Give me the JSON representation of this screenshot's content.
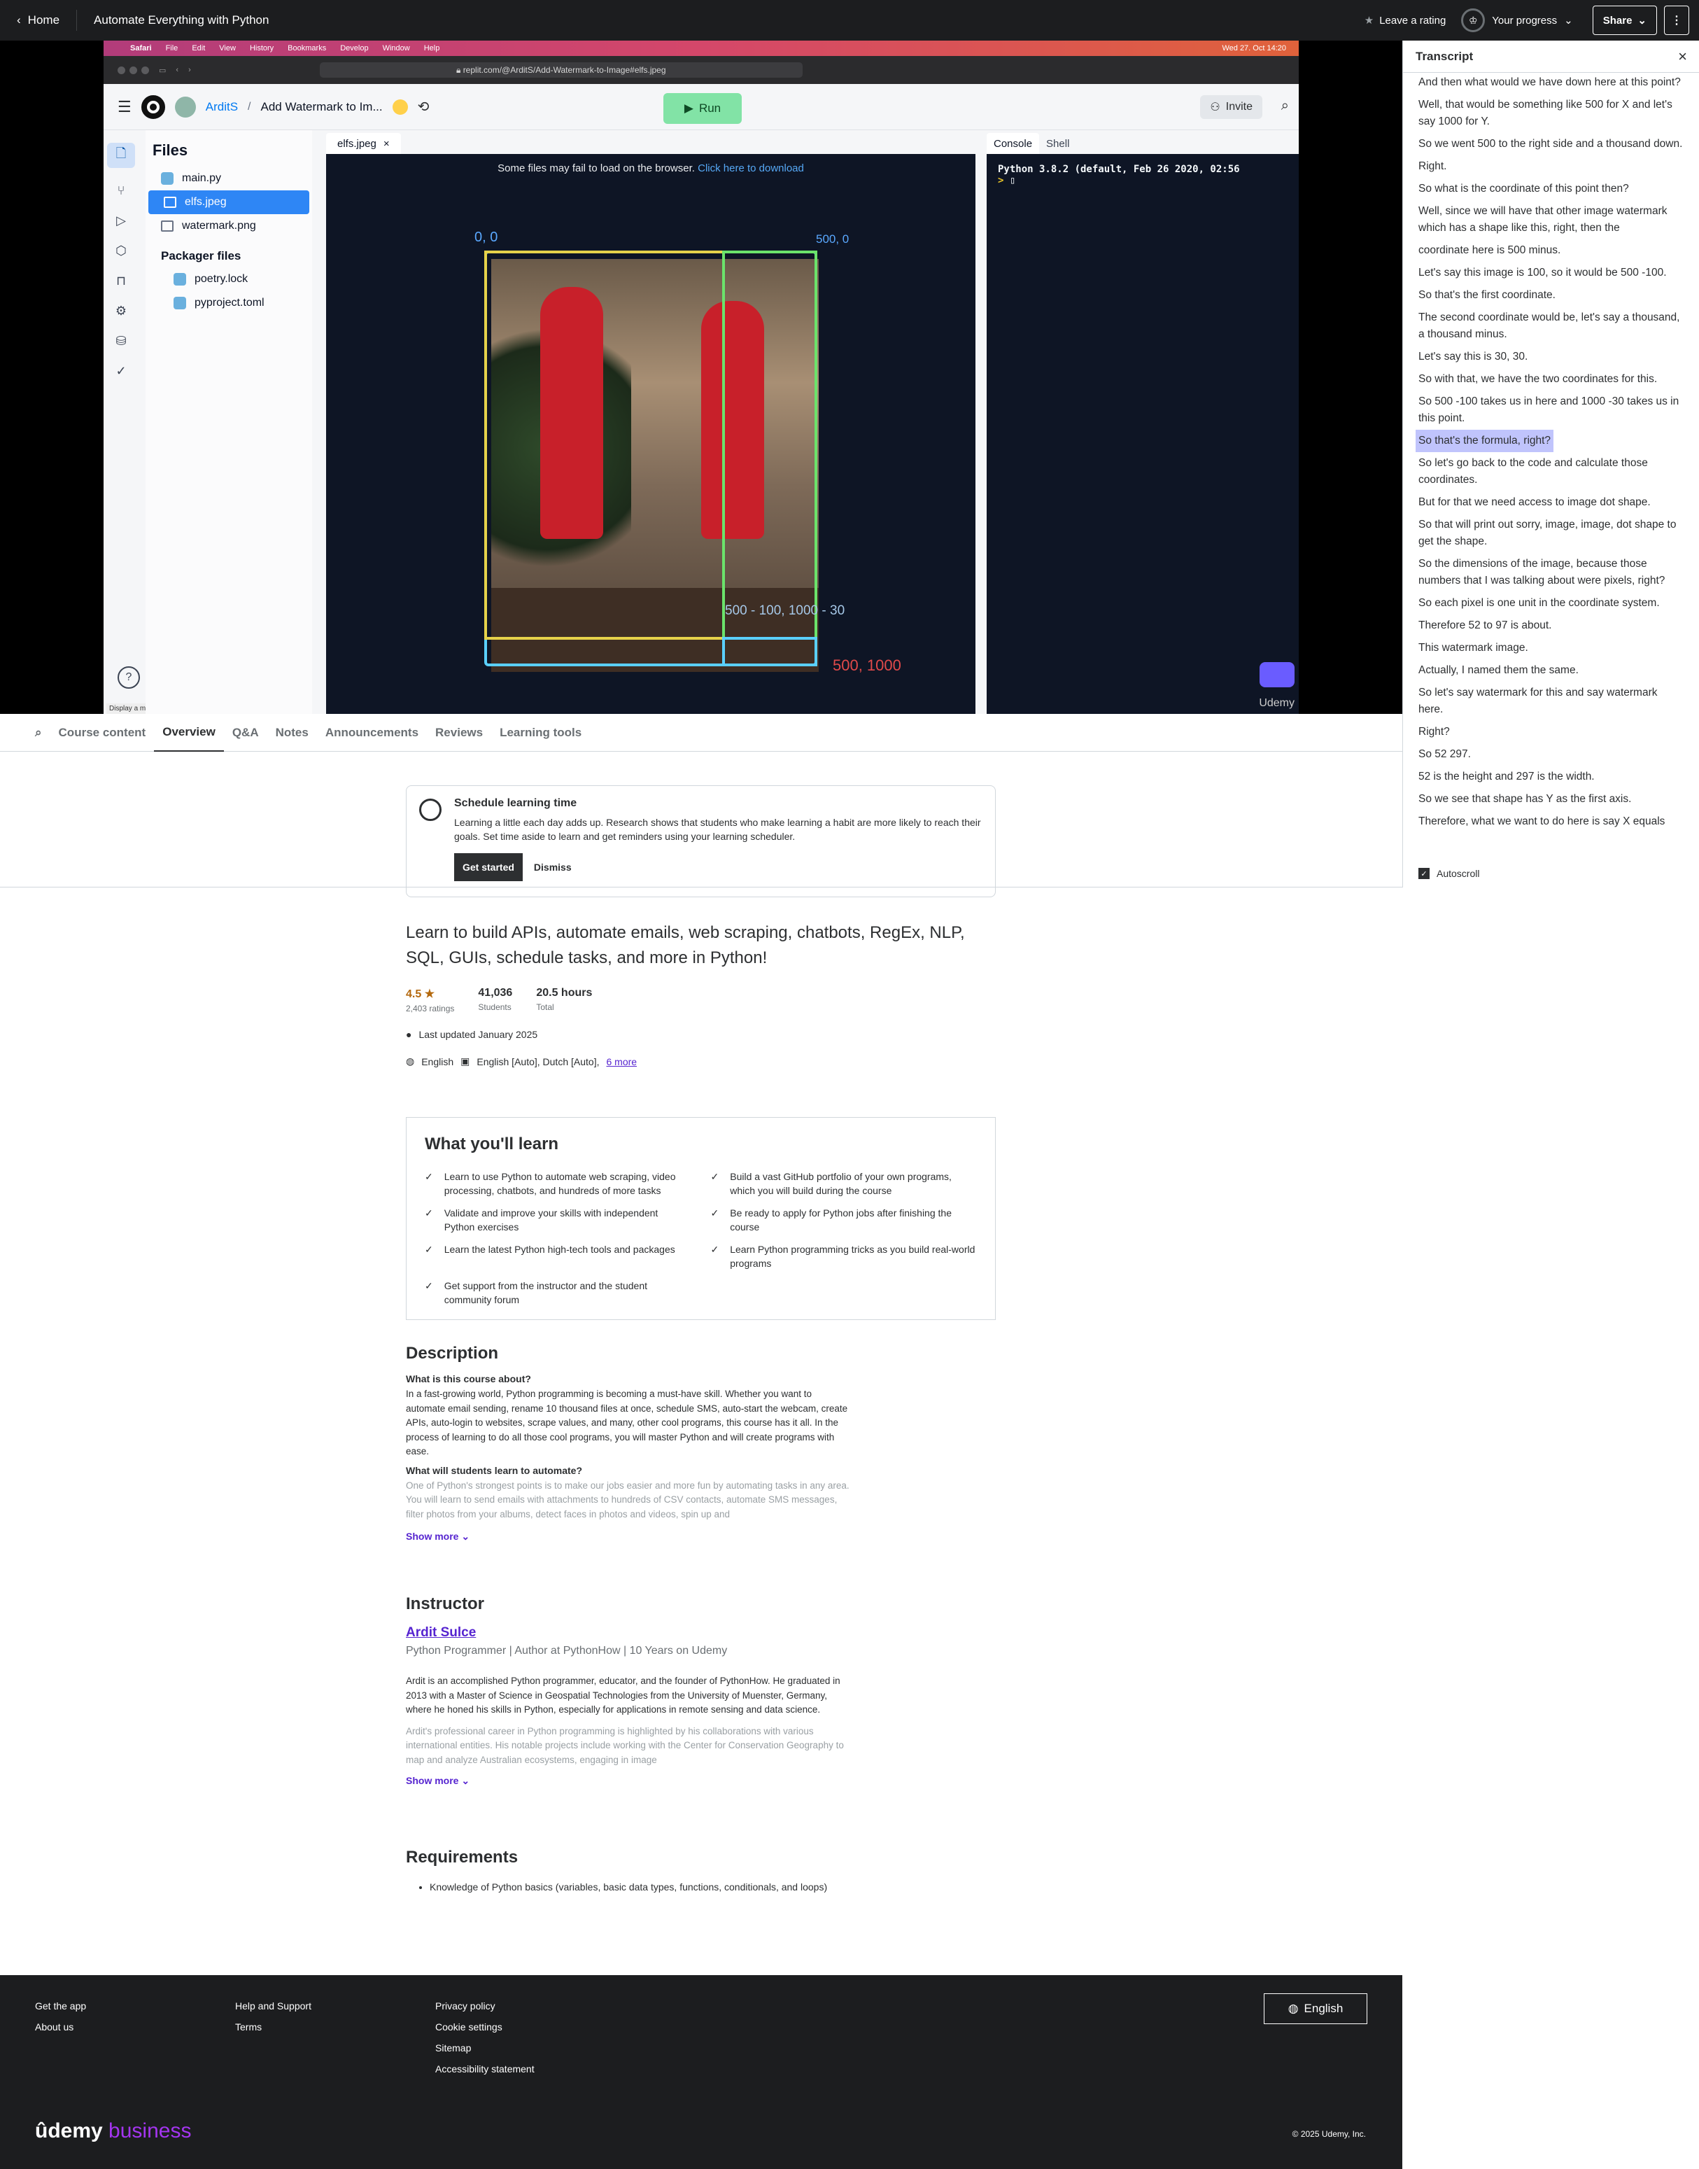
{
  "topbar": {
    "home": "Home",
    "title": "Automate Everything with Python",
    "rate": "Leave a rating",
    "progress": "Your progress",
    "share": "Share"
  },
  "mac": {
    "menu": [
      "Safari",
      "File",
      "Edit",
      "View",
      "History",
      "Bookmarks",
      "Develop",
      "Window",
      "Help"
    ],
    "clock": "Wed 27. Oct 14:20",
    "url": "replit.com/@ArditS/Add-Watermark-to-Image#elfs.jpeg"
  },
  "replit": {
    "user": "ArditS",
    "project": "Add Watermark to Im...",
    "run": "Run",
    "invite": "Invite",
    "files_title": "Files",
    "files": [
      "main.py",
      "elfs.jpeg",
      "watermark.png"
    ],
    "packager_title": "Packager files",
    "packager": [
      "poetry.lock",
      "pyproject.toml"
    ],
    "tab": "elfs.jpeg",
    "notice": "Some files may fail to load on the browser.",
    "notice_link": "Click here to download",
    "coord_tl": "0, 0",
    "coord_tr": "500, 0",
    "coord_mid": "500 - 100, 1000 - 30",
    "coord_br": "500, 1000",
    "console_tab": "Console",
    "shell_tab": "Shell",
    "console_line": "Python 3.8.2 (default, Feb 26 2020, 02:56",
    "watermark": "Udemy",
    "display_menu": "Display a menu"
  },
  "tabs": [
    "Course content",
    "Overview",
    "Q&A",
    "Notes",
    "Announcements",
    "Reviews",
    "Learning tools"
  ],
  "transcript": {
    "title": "Transcript",
    "lines": [
      "And then what would we have down here at this point?",
      "Well, that would be something like 500 for X and let's say 1000 for Y.",
      "So we went 500 to the right side and a thousand down.",
      "Right.",
      "So what is the coordinate of this point then?",
      "Well, since we will have that other image watermark which has a shape like this, right, then the",
      "coordinate here is 500 minus.",
      "Let's say this image is 100, so it would be 500 -100.",
      "So that's the first coordinate.",
      "The second coordinate would be, let's say a thousand, a thousand minus.",
      "Let's say this is 30, 30.",
      "So with that, we have the two coordinates for this.",
      "So 500 -100 takes us in here and 1000 -30 takes us in this point.",
      "So that's the formula, right?",
      "So let's go back to the code and calculate those coordinates.",
      "But for that we need access to image dot shape.",
      "So that will print out sorry, image, image, dot shape to get the shape.",
      "So the dimensions of the image, because those numbers that I was talking about were pixels, right?",
      "So each pixel is one unit in the coordinate system.",
      "Therefore 52 to 97 is about.",
      "This watermark image.",
      "Actually, I named them the same.",
      "So let's say watermark for this and say watermark here.",
      "Right?",
      "So 52 297.",
      "52 is the height and 297 is the width.",
      "So we see that shape has Y as the first axis.",
      "Therefore, what we want to do here is say X equals"
    ],
    "autoscroll": "Autoscroll"
  },
  "schedule": {
    "title": "Schedule learning time",
    "text": "Learning a little each day adds up. Research shows that students who make learning a habit are more likely to reach their goals. Set time aside to learn and get reminders using your learning scheduler.",
    "start": "Get started",
    "dismiss": "Dismiss"
  },
  "course": {
    "headline": "Learn to build APIs, automate emails, web scraping, chatbots, RegEx, NLP, SQL, GUIs, schedule tasks, and more in Python!",
    "rating": "4.5",
    "ratings_count": "2,403 ratings",
    "students": "41,036",
    "students_label": "Students",
    "hours": "20.5 hours",
    "hours_label": "Total",
    "updated": "Last updated January 2025",
    "language": "English",
    "captions": "English [Auto], Dutch [Auto],",
    "more": "6 more"
  },
  "learn": {
    "title": "What you'll learn",
    "items": [
      "Learn to use Python to automate web scraping, video processing, chatbots, and hundreds of more tasks",
      "Build a vast GitHub portfolio of your own programs, which you will build during the course",
      "Validate and improve your skills with independent Python exercises",
      "Be ready to apply for Python jobs after finishing the course",
      "Learn the latest Python high-tech tools and packages",
      "Learn Python programming tricks as you build real-world programs",
      "Get support from the instructor and the student community forum"
    ]
  },
  "description": {
    "title": "Description",
    "q1": "What is this course about?",
    "p1": "In a fast-growing world, Python programming is becoming a must-have skill. Whether you want to automate email sending, rename 10 thousand files at once, schedule SMS, auto-start the webcam, create APIs, auto-login to websites, scrape values, and many, other cool programs, this course has it all. In the process of learning to do all those cool programs, you will master Python and will create programs with ease.",
    "q2": "What will students learn to automate?",
    "p2": "One of Python's strongest points is to make our jobs easier and more fun by automating tasks in any area. You will learn to send emails with attachments to hundreds of CSV contacts, automate SMS messages, filter photos from your albums, detect faces in photos and videos, spin up and",
    "show_more": "Show more"
  },
  "instructor": {
    "title": "Instructor",
    "name": "Ardit Sulce",
    "role": "Python Programmer | Author at PythonHow | 10 Years on Udemy",
    "p1": "Ardit is an accomplished Python programmer, educator, and the founder of PythonHow. He graduated in 2013 with a Master of Science in Geospatial Technologies from the University of Muenster, Germany, where he honed his skills in Python, especially for applications in remote sensing and data science.",
    "p2": "Ardit's professional career in Python programming is highlighted by his collaborations with various international entities. His notable projects include working with the Center for Conservation Geography to map and analyze Australian ecosystems, engaging in image",
    "show_more": "Show more"
  },
  "requirements": {
    "title": "Requirements",
    "items": [
      "Knowledge of Python basics (variables, basic data types, functions, conditionals, and loops)"
    ]
  },
  "footer": {
    "col1": [
      "Get the app",
      "About us"
    ],
    "col2": [
      "Help and Support",
      "Terms"
    ],
    "col3": [
      "Privacy policy",
      "Cookie settings",
      "Sitemap",
      "Accessibility statement"
    ],
    "lang": "English",
    "logo_a": "ûdemy",
    "logo_b": "business",
    "copyright": "© 2025 Udemy, Inc."
  }
}
